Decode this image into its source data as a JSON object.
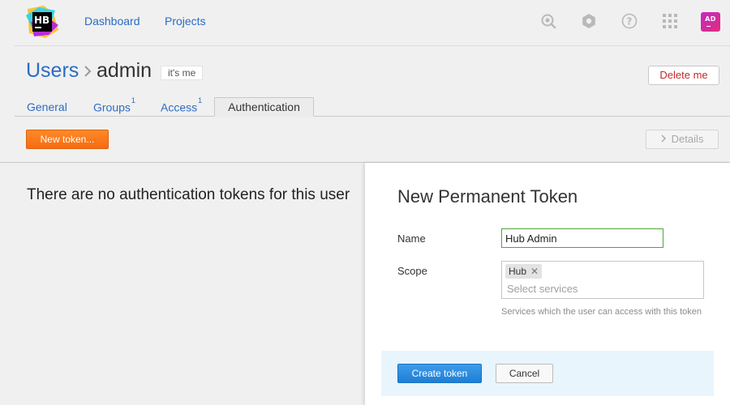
{
  "nav": {
    "logo_text": "HB",
    "links": [
      "Dashboard",
      "Projects"
    ],
    "avatar_initials": "AD",
    "icons": [
      "search-icon",
      "gear-icon",
      "help-icon",
      "apps-grid-icon"
    ]
  },
  "header": {
    "breadcrumb_parent": "Users",
    "title": "admin",
    "badge": "it's me",
    "delete_label": "Delete me"
  },
  "tabs": [
    {
      "label": "General",
      "count": ""
    },
    {
      "label": "Groups",
      "count": "1"
    },
    {
      "label": "Access",
      "count": "1"
    },
    {
      "label": "Authentication",
      "count": "",
      "active": true
    }
  ],
  "toolbar": {
    "new_token_label": "New token...",
    "details_label": "Details"
  },
  "main": {
    "empty_message": "There are no authentication tokens for this user"
  },
  "panel": {
    "title": "New Permanent Token",
    "name_label": "Name",
    "name_value": "Hub Admin",
    "scope_label": "Scope",
    "scope_chips": [
      "Hub"
    ],
    "scope_placeholder": "Select services",
    "scope_hint": "Services which the user can access with this token",
    "create_label": "Create token",
    "cancel_label": "Cancel"
  },
  "colors": {
    "link": "#2b6cc4",
    "accent_orange": "#f56b10",
    "primary_blue": "#1d7fd6",
    "danger": "#c0282d",
    "input_valid": "#4fa63d",
    "footer_bg": "#e8f5fd"
  }
}
